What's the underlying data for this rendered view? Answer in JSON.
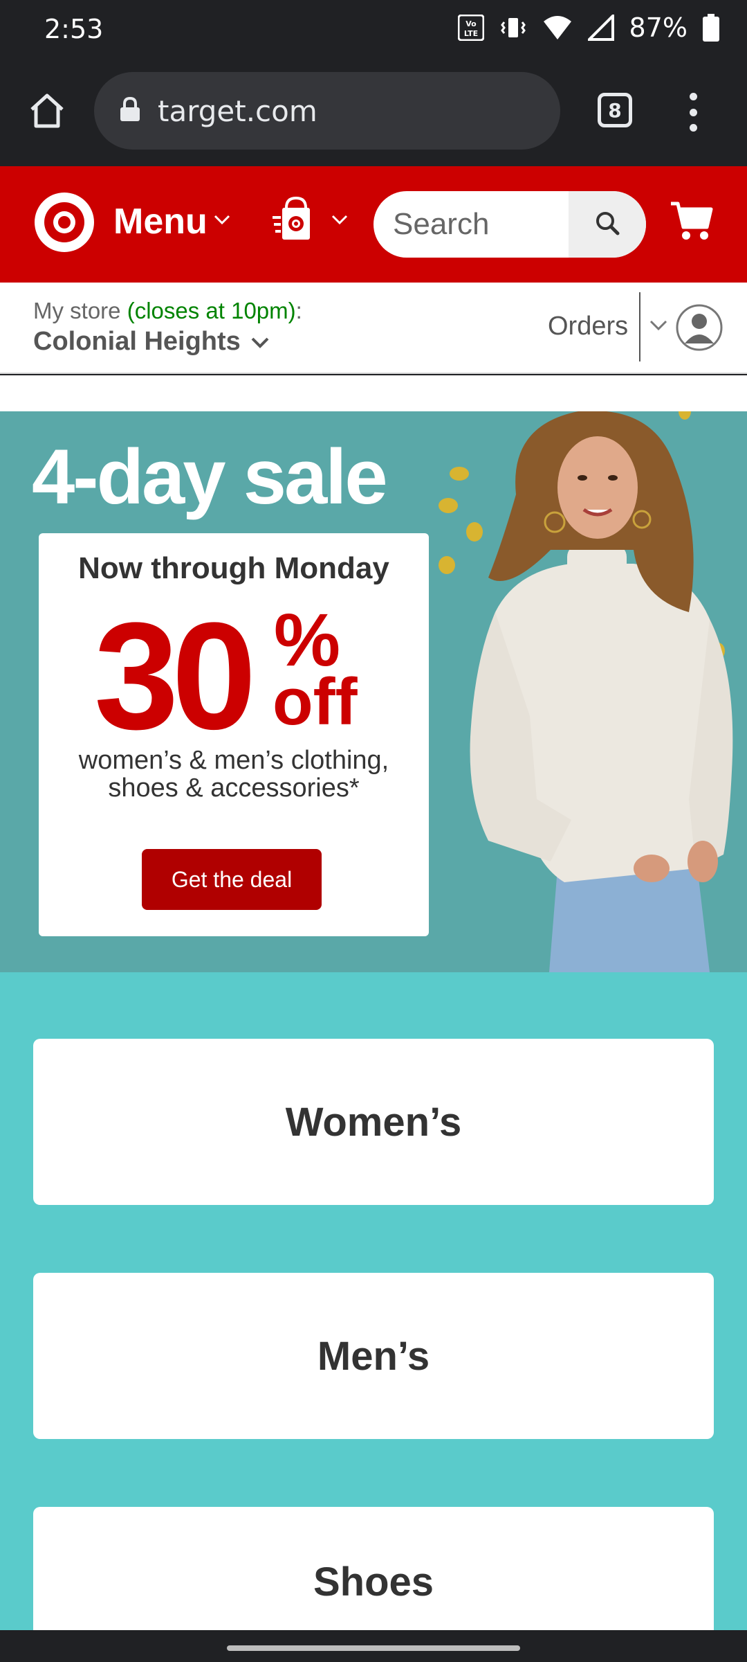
{
  "status_bar": {
    "time": "2:53",
    "network_label": "Vo LTE",
    "battery": "87%"
  },
  "browser": {
    "url": "target.com",
    "tab_count": "8"
  },
  "header": {
    "menu_label": "Menu",
    "search_placeholder": "Search",
    "brand_color": "#cc0000"
  },
  "store": {
    "label": "My store ",
    "hours": "(closes at 10pm)",
    "colon": ":",
    "name": "Colonial Heights",
    "orders_label": "Orders"
  },
  "hero": {
    "title": "4-day sale",
    "card_subtitle": "Now through Monday",
    "discount_number": "30",
    "discount_percent": "%",
    "discount_off": "off",
    "description_line1": "women’s & men’s clothing,",
    "description_line2": "shoes & accessories*",
    "cta_label": "Get the deal"
  },
  "categories": [
    {
      "label": "Women’s"
    },
    {
      "label": "Men’s"
    },
    {
      "label": "Shoes"
    }
  ],
  "colors": {
    "hero_bg": "#5aa8a8",
    "category_bg": "#5acbcb",
    "store_hours": "#008300"
  }
}
